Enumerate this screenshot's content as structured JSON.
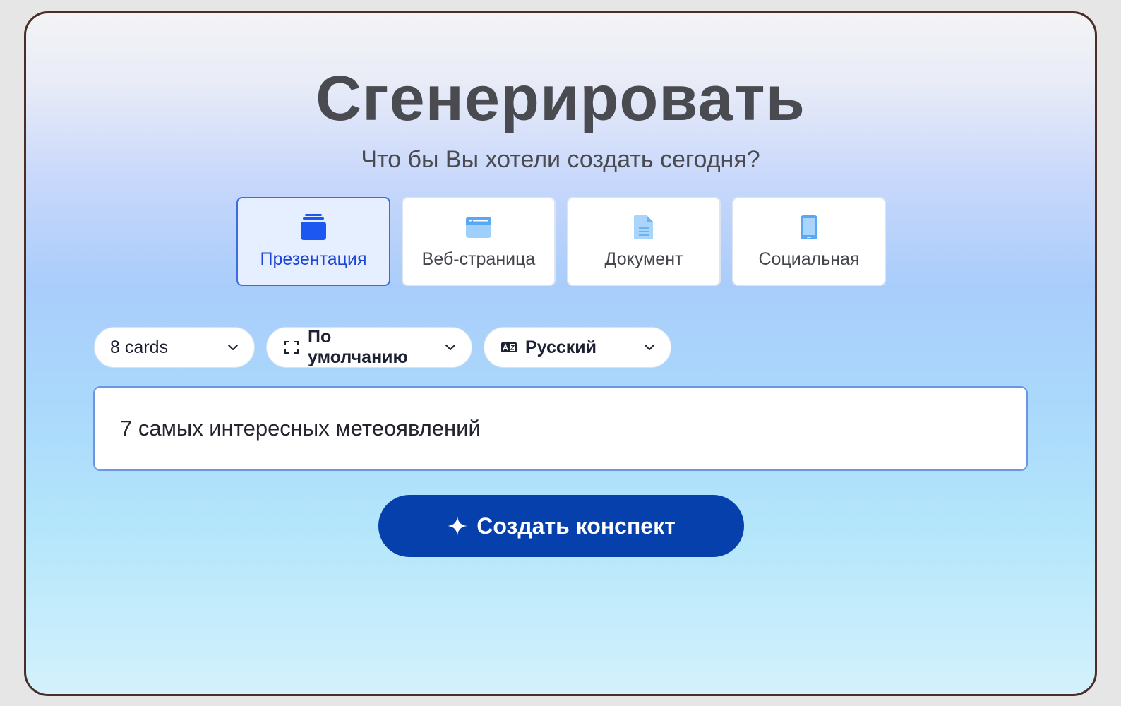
{
  "header": {
    "title": "Сгенерировать",
    "subtitle": "Что бы Вы хотели создать сегодня?"
  },
  "types": [
    {
      "label": "Презентация",
      "icon": "stack-icon",
      "active": true
    },
    {
      "label": "Веб-страница",
      "icon": "browser-window-icon",
      "active": false
    },
    {
      "label": "Документ",
      "icon": "document-icon",
      "active": false
    },
    {
      "label": "Социальная",
      "icon": "phone-icon",
      "active": false
    }
  ],
  "controls": {
    "cards": "8 cards",
    "format": "По умолчанию",
    "language": "Русский"
  },
  "prompt": {
    "value": "7 самых интересных метеоявлений"
  },
  "cta": {
    "label": "Создать конспект"
  },
  "colors": {
    "accent": "#0640ad",
    "active_card_bg": "#e6efff",
    "active_card_text": "#1c44d6",
    "icon_blue": "#1b57f0",
    "icon_light_blue": "#58a8f5"
  }
}
